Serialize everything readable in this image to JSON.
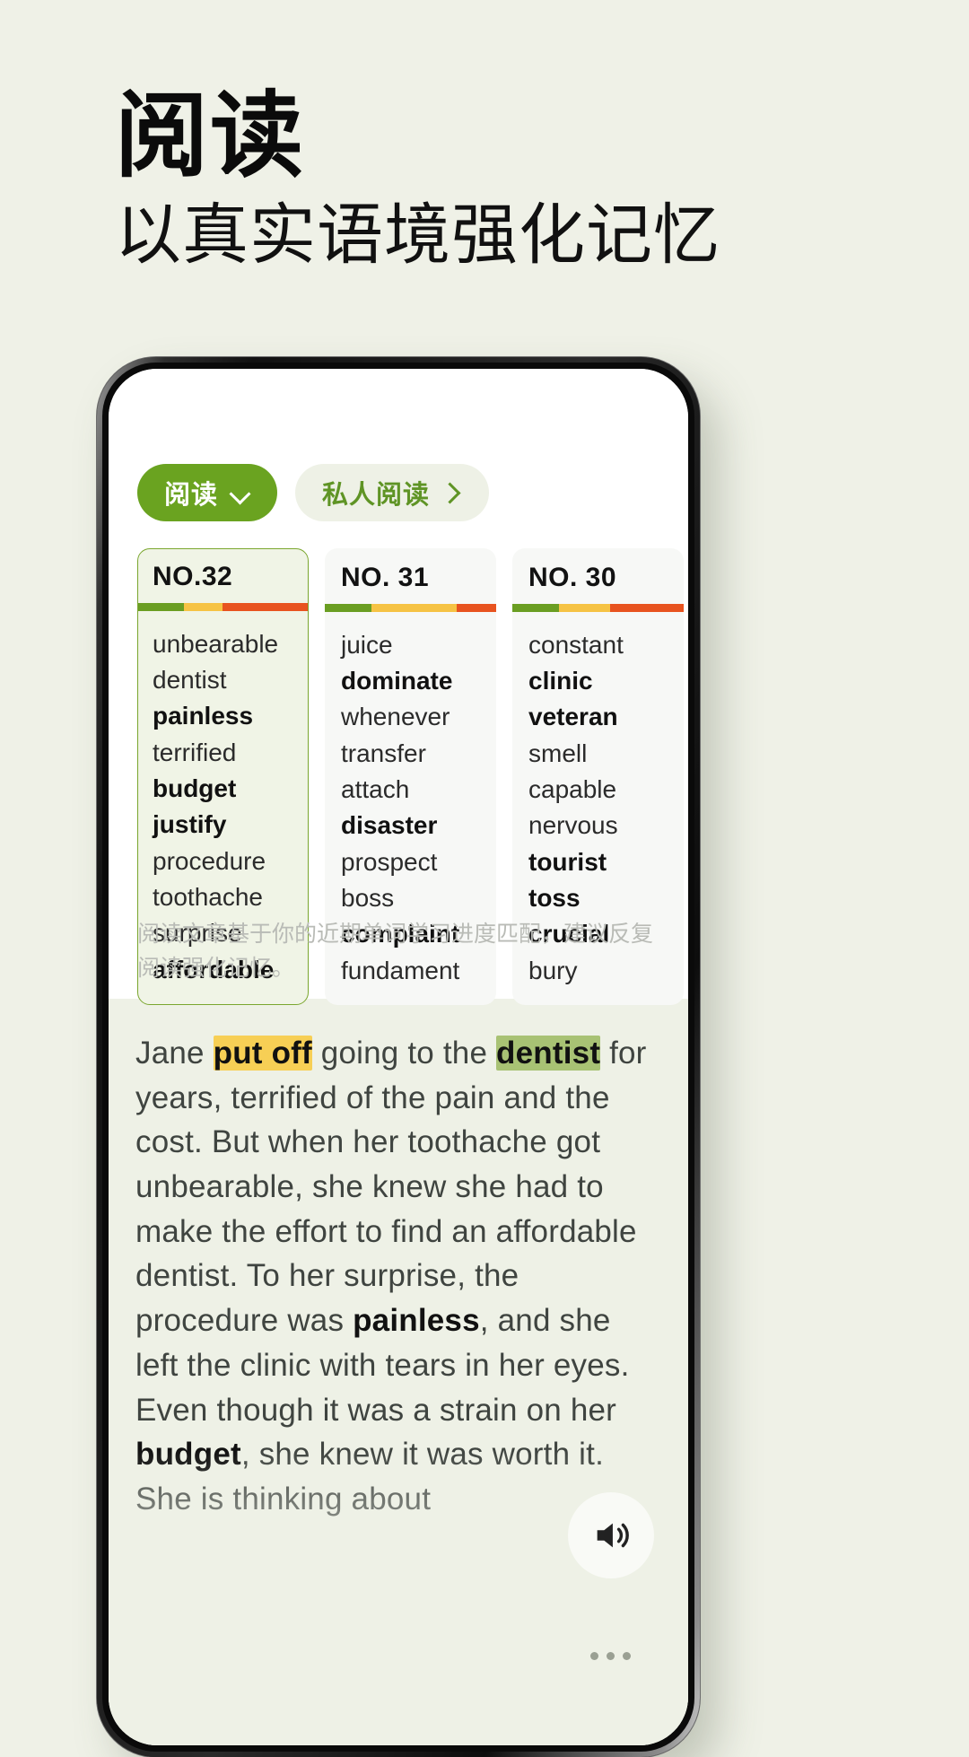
{
  "page": {
    "bg_color": "#eff1e7",
    "title": "阅读",
    "subtitle": "以真实语境强化记忆"
  },
  "app": {
    "tabs": [
      {
        "label": "阅读",
        "icon": "chevron-down-icon",
        "active": true,
        "bg": "#6aa320",
        "fg": "#ffffff"
      },
      {
        "label": "私人阅读",
        "icon": "chevron-right-icon",
        "active": false,
        "bg": "#eef1e6",
        "fg": "#5f9425"
      }
    ],
    "cards": [
      {
        "title": "NO.32",
        "active": true,
        "bar": [
          {
            "color": "#6a9e22",
            "pct": 27
          },
          {
            "color": "#f6c344",
            "pct": 23
          },
          {
            "color": "#e8531f",
            "pct": 50
          }
        ],
        "words": [
          {
            "text": "unbearable",
            "bold": false
          },
          {
            "text": "dentist",
            "bold": false
          },
          {
            "text": "painless",
            "bold": true
          },
          {
            "text": "terrified",
            "bold": false
          },
          {
            "text": "budget",
            "bold": true
          },
          {
            "text": "justify",
            "bold": true
          },
          {
            "text": "procedure",
            "bold": false
          },
          {
            "text": "toothache",
            "bold": false
          },
          {
            "text": "surprise",
            "bold": false
          },
          {
            "text": "affordable",
            "bold": true
          }
        ]
      },
      {
        "title": "NO. 31",
        "active": false,
        "bar": [
          {
            "color": "#6a9e22",
            "pct": 27
          },
          {
            "color": "#f6c344",
            "pct": 50
          },
          {
            "color": "#e8531f",
            "pct": 23
          }
        ],
        "words": [
          {
            "text": "juice",
            "bold": false
          },
          {
            "text": "dominate",
            "bold": true
          },
          {
            "text": "whenever",
            "bold": false
          },
          {
            "text": "transfer",
            "bold": false
          },
          {
            "text": "attach",
            "bold": false
          },
          {
            "text": "disaster",
            "bold": true
          },
          {
            "text": "prospect",
            "bold": false
          },
          {
            "text": "boss",
            "bold": false
          },
          {
            "text": "complaint",
            "bold": true
          },
          {
            "text": "fundament",
            "bold": false
          }
        ]
      },
      {
        "title": "NO. 30",
        "active": false,
        "bar": [
          {
            "color": "#6a9e22",
            "pct": 27
          },
          {
            "color": "#f6c344",
            "pct": 30
          },
          {
            "color": "#e8531f",
            "pct": 43
          }
        ],
        "words": [
          {
            "text": "constant",
            "bold": false
          },
          {
            "text": "clinic",
            "bold": true
          },
          {
            "text": "veteran",
            "bold": true
          },
          {
            "text": "smell",
            "bold": false
          },
          {
            "text": "capable",
            "bold": false
          },
          {
            "text": "nervous",
            "bold": false
          },
          {
            "text": "tourist",
            "bold": true
          },
          {
            "text": "toss",
            "bold": true
          },
          {
            "text": "crucial",
            "bold": true
          },
          {
            "text": "bury",
            "bold": false
          }
        ]
      }
    ],
    "hint": "阅读文章基于你的近期单词学习进度匹配，建议反复阅读强化记忆。",
    "article": {
      "segments": [
        {
          "text": "Jane ",
          "style": "normal"
        },
        {
          "text": "put off",
          "style": "highlight-yellow"
        },
        {
          "text": " going to the ",
          "style": "normal"
        },
        {
          "text": "dentist",
          "style": "highlight-green"
        },
        {
          "text": " for years, terrified of the pain and the cost. But when her toothache got unbearable, she knew she had to make the effort to find an affordable dentist. To her surprise, the procedure was ",
          "style": "normal"
        },
        {
          "text": "painless",
          "style": "bold"
        },
        {
          "text": ", and she left the clinic with tears in her eyes. Even though it was a strain on her ",
          "style": "normal"
        },
        {
          "text": "budget",
          "style": "bold"
        },
        {
          "text": ", she knew it was worth it. She is thinking about",
          "style": "normal"
        }
      ]
    },
    "controls": {
      "speaker": "speaker-icon",
      "more": "more-options-icon"
    }
  }
}
